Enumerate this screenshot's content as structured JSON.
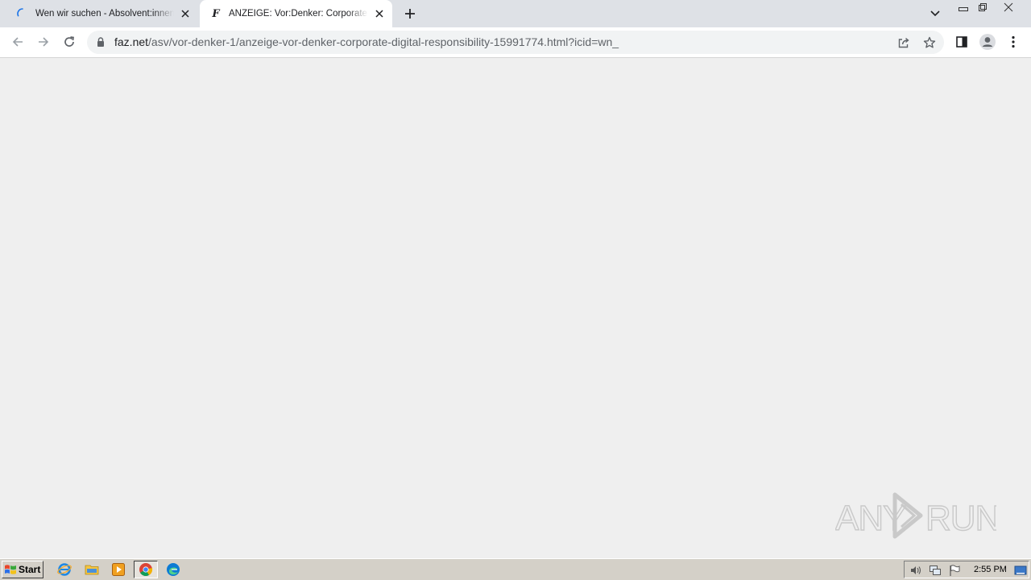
{
  "browser": {
    "tabs": [
      {
        "title": "Wen wir suchen - Absolvent:innen | Unternehmen",
        "state": "loading"
      },
      {
        "title": "ANZEIGE: Vor:Denker: Corporate Digital Responsibility",
        "state": "active",
        "favicon_letter": "F"
      }
    ],
    "address": {
      "host": "faz.net",
      "path": "/asv/vor-denker-1/anzeige-vor-denker-corporate-digital-responsibility-15991774.html?icid=wn_"
    },
    "icons": {
      "back": "arrow-left-icon",
      "forward": "arrow-right-icon",
      "reload": "reload-icon",
      "lock": "lock-icon",
      "share": "share-icon",
      "bookmark": "star-icon",
      "side_panel": "side-panel-icon",
      "profile": "profile-icon",
      "menu": "kebab-menu-icon"
    }
  },
  "watermark": {
    "text": "ANY RUN"
  },
  "taskbar": {
    "start_label": "Start",
    "clock": "2:55 PM",
    "pinned": [
      "internet-explorer-icon",
      "folder-icon",
      "media-player-icon",
      "chrome-icon",
      "edge-icon"
    ]
  },
  "colors": {
    "tabstrip": "#dee1e6",
    "content_bg": "#efefef",
    "taskbar": "#d4d0c8"
  }
}
